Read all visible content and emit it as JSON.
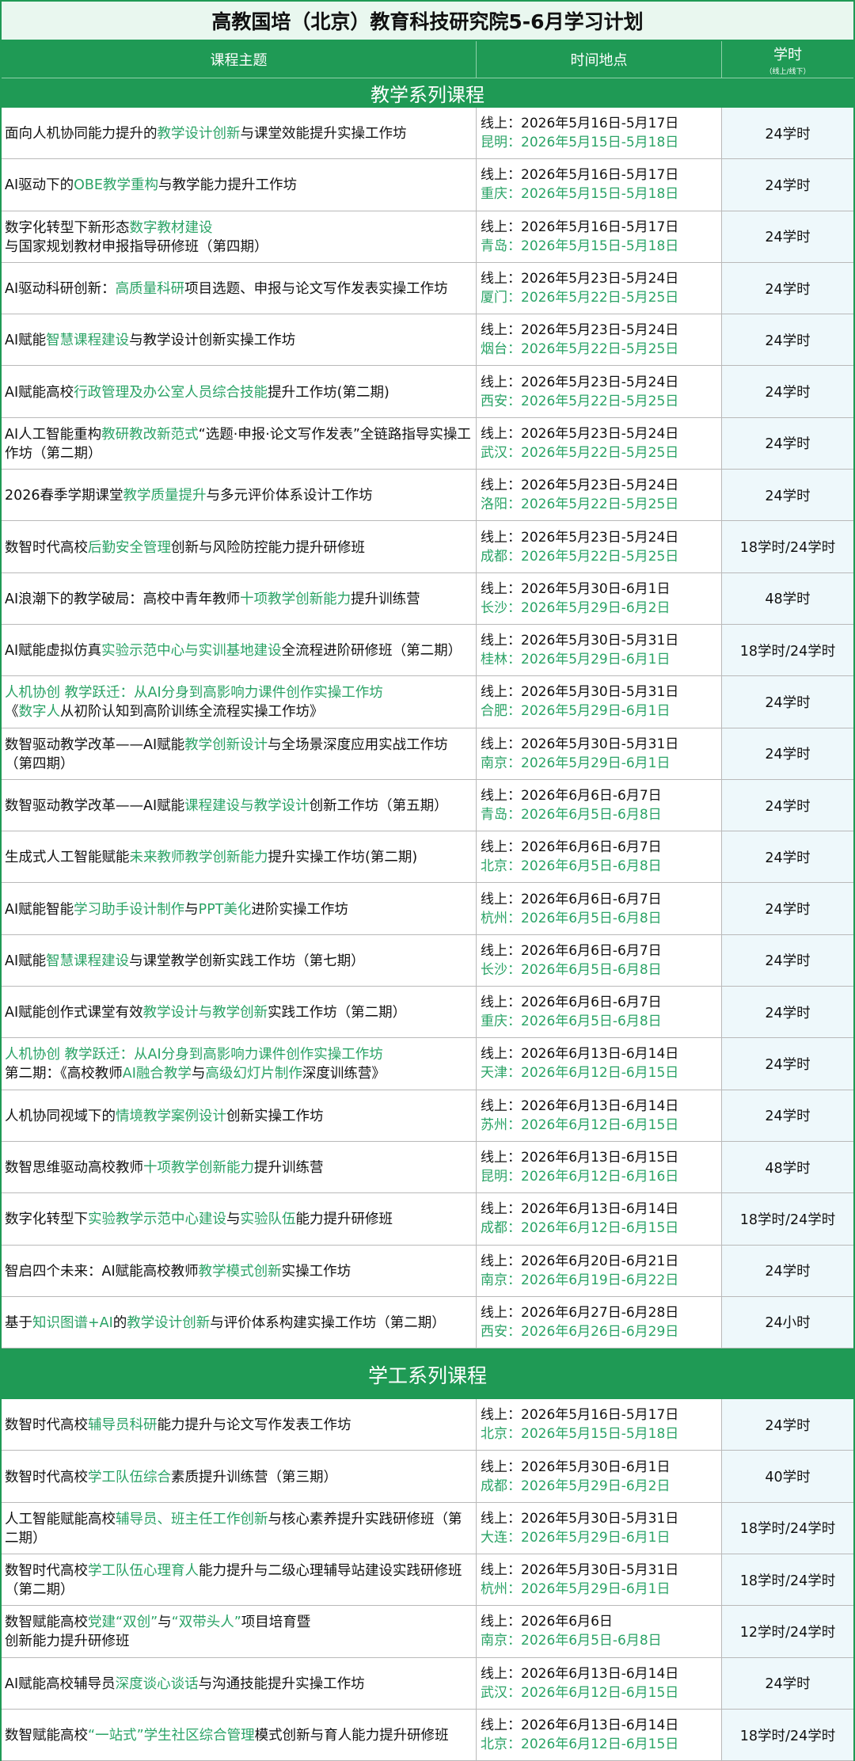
{
  "title": "高教国培（北京）教育科技研究院5-6月学习计划",
  "headers": {
    "topic": "课程主题",
    "time": "时间地点",
    "hours": "学时",
    "hours_sub": "（线上/线下）"
  },
  "sections": [
    {
      "name": "教学系列课程",
      "rows": [
        {
          "topic": [
            {
              "t": "面向人机协同能力提升的"
            },
            {
              "t": "教学设计创新",
              "hl": true
            },
            {
              "t": "与课堂效能提升实操工作坊"
            }
          ],
          "online": "线上：2026年5月16日-5月17日",
          "offline": "昆明：2026年5月15日-5月18日",
          "hours": "24学时"
        },
        {
          "topic": [
            {
              "t": "AI驱动下的"
            },
            {
              "t": "OBE教学重构",
              "hl": true
            },
            {
              "t": "与教学能力提升工作坊"
            }
          ],
          "online": "线上：2026年5月16日-5月17日",
          "offline": "重庆：2026年5月15日-5月18日",
          "hours": "24学时"
        },
        {
          "topic": [
            {
              "t": "数字化转型下新形态"
            },
            {
              "t": "数字教材建设",
              "hl": true
            },
            {
              "t": "与国家规划教材申报指导研修班（第四期）"
            }
          ],
          "online": "线上：2026年5月16日-5月17日",
          "offline": "青岛：2026年5月15日-5月18日",
          "hours": "24学时"
        },
        {
          "topic": [
            {
              "t": "AI驱动科研创新："
            },
            {
              "t": "高质量科研",
              "hl": true
            },
            {
              "t": "项目选题、申报与论文写作发表实操工作坊"
            }
          ],
          "online": "线上：2026年5月23日-5月24日",
          "offline": "厦门：2026年5月22日-5月25日",
          "hours": "24学时"
        },
        {
          "topic": [
            {
              "t": "AI赋能"
            },
            {
              "t": "智慧课程建设",
              "hl": true
            },
            {
              "t": "与教学设计创新实操工作坊"
            }
          ],
          "online": "线上：2026年5月23日-5月24日",
          "offline": "烟台：2026年5月22日-5月25日",
          "hours": "24学时"
        },
        {
          "topic": [
            {
              "t": "AI赋能高校"
            },
            {
              "t": "行政管理及办公室人员综合技能",
              "hl": true
            },
            {
              "t": "提升工作坊(第二期)"
            }
          ],
          "online": "线上：2026年5月23日-5月24日",
          "offline": "西安：2026年5月22日-5月25日",
          "hours": "24学时"
        },
        {
          "topic": [
            {
              "t": "AI人工智能重构"
            },
            {
              "t": "教研教改新范式",
              "hl": true
            },
            {
              "t": "“选题·申报·论文写作发表”全链路指导实操工作坊（第二期）"
            }
          ],
          "online": "线上：2026年5月23日-5月24日",
          "offline": "武汉：2026年5月22日-5月25日",
          "hours": "24学时"
        },
        {
          "topic": [
            {
              "t": "2026春季学期课堂"
            },
            {
              "t": "教学质量提升",
              "hl": true
            },
            {
              "t": "与多元评价体系设计工作坊"
            }
          ],
          "online": "线上：2026年5月23日-5月24日",
          "offline": "洛阳：2026年5月22日-5月25日",
          "hours": "24学时"
        },
        {
          "topic": [
            {
              "t": "数智时代高校"
            },
            {
              "t": "后勤安全管理",
              "hl": true
            },
            {
              "t": "创新与风险防控能力提升研修班"
            }
          ],
          "online": "线上：2026年5月23日-5月24日",
          "offline": "成都：2026年5月22日-5月25日",
          "hours": "18学时/24学时"
        },
        {
          "topic": [
            {
              "t": "AI浪潮下的教学破局：高校中青年教师"
            },
            {
              "t": "十项教学创新能力",
              "hl": true
            },
            {
              "t": "提升训练营"
            }
          ],
          "online": "线上：2026年5月30日-6月1日",
          "offline": "长沙：2026年5月29日-6月2日",
          "hours": "48学时"
        },
        {
          "topic": [
            {
              "t": "AI赋能虚拟仿真"
            },
            {
              "t": "实验示范中心与实训基地建设",
              "hl": true
            },
            {
              "t": "全流程进阶研修班（第二期）"
            }
          ],
          "online": "线上：2026年5月30日-5月31日",
          "offline": "桂林：2026年5月29日-6月1日",
          "hours": "18学时/24学时"
        },
        {
          "topic": [
            {
              "t": "人机协创 教学跃迁：从AI分身到高影响力课件创作实操工作坊",
              "hl": true,
              "br": true
            },
            {
              "t": "《"
            },
            {
              "t": "数字人",
              "hl": true
            },
            {
              "t": "从初阶认知到高阶训练全流程实操工作坊》"
            }
          ],
          "online": "线上：2026年5月30日-5月31日",
          "offline": "合肥：2026年5月29日-6月1日",
          "hours": "24学时"
        },
        {
          "topic": [
            {
              "t": "数智驱动教学改革——AI赋能"
            },
            {
              "t": "教学创新设计",
              "hl": true
            },
            {
              "t": "与全场景深度应用实战工作坊（第四期）"
            }
          ],
          "online": "线上：2026年5月30日-5月31日",
          "offline": "南京：2026年5月29日-6月1日",
          "hours": "24学时"
        },
        {
          "topic": [
            {
              "t": "数智驱动教学改革——AI赋能"
            },
            {
              "t": "课程建设与教学设计",
              "hl": true
            },
            {
              "t": "创新工作坊（第五期）"
            }
          ],
          "online": "线上：2026年6月6日-6月7日",
          "offline": "青岛：2026年6月5日-6月8日",
          "hours": "24学时"
        },
        {
          "topic": [
            {
              "t": "生成式人工智能赋能"
            },
            {
              "t": "未来教师教学创新能力",
              "hl": true
            },
            {
              "t": "提升实操工作坊(第二期)"
            }
          ],
          "online": "线上：2026年6月6日-6月7日",
          "offline": "北京：2026年6月5日-6月8日",
          "hours": "24学时"
        },
        {
          "topic": [
            {
              "t": "AI赋能智能"
            },
            {
              "t": "学习助手设计制作",
              "hl": true
            },
            {
              "t": "与"
            },
            {
              "t": "PPT美化",
              "hl": true
            },
            {
              "t": "进阶实操工作坊"
            }
          ],
          "online": "线上：2026年6月6日-6月7日",
          "offline": "杭州：2026年6月5日-6月8日",
          "hours": "24学时"
        },
        {
          "topic": [
            {
              "t": "AI赋能"
            },
            {
              "t": "智慧课程建设",
              "hl": true
            },
            {
              "t": "与课堂教学创新实践工作坊（第七期）"
            }
          ],
          "online": "线上：2026年6月6日-6月7日",
          "offline": "长沙：2026年6月5日-6月8日",
          "hours": "24学时"
        },
        {
          "topic": [
            {
              "t": "AI赋能创作式课堂有效"
            },
            {
              "t": "教学设计与教学创新",
              "hl": true
            },
            {
              "t": "实践工作坊（第二期）"
            }
          ],
          "online": "线上：2026年6月6日-6月7日",
          "offline": "重庆：2026年6月5日-6月8日",
          "hours": "24学时"
        },
        {
          "topic": [
            {
              "t": "人机协创 教学跃迁：从AI分身到高影响力课件创作实操工作坊",
              "hl": true,
              "br": true
            },
            {
              "t": "第二期：《高校教师"
            },
            {
              "t": "AI融合教学",
              "hl": true
            },
            {
              "t": "与"
            },
            {
              "t": "高级幻灯片制作",
              "hl": true
            },
            {
              "t": "深度训练营》"
            }
          ],
          "online": "线上：2026年6月13日-6月14日",
          "offline": "天津：2026年6月12日-6月15日",
          "hours": "24学时"
        },
        {
          "topic": [
            {
              "t": "人机协同视域下的"
            },
            {
              "t": "情境教学案例设计",
              "hl": true
            },
            {
              "t": "创新实操工作坊"
            }
          ],
          "online": "线上：2026年6月13日-6月14日",
          "offline": "苏州：2026年6月12日-6月15日",
          "hours": "24学时"
        },
        {
          "topic": [
            {
              "t": "数智思维驱动高校教师"
            },
            {
              "t": "十项教学创新能力",
              "hl": true
            },
            {
              "t": "提升训练营"
            }
          ],
          "online": "线上：2026年6月13日-6月15日",
          "offline": "昆明：2026年6月12日-6月16日",
          "hours": "48学时"
        },
        {
          "topic": [
            {
              "t": "数字化转型下"
            },
            {
              "t": "实验教学示范中心建设",
              "hl": true
            },
            {
              "t": "与"
            },
            {
              "t": "实验队伍",
              "hl": true
            },
            {
              "t": "能力提升研修班"
            }
          ],
          "online": "线上：2026年6月13日-6月14日",
          "offline": "成都：2026年6月12日-6月15日",
          "hours": "18学时/24学时"
        },
        {
          "topic": [
            {
              "t": "智启四个未来：AI赋能高校教师"
            },
            {
              "t": "教学模式创新",
              "hl": true
            },
            {
              "t": "实操工作坊"
            }
          ],
          "online": "线上：2026年6月20日-6月21日",
          "offline": "南京：2026年6月19日-6月22日",
          "hours": "24学时"
        },
        {
          "topic": [
            {
              "t": "基于"
            },
            {
              "t": "知识图谱+AI",
              "hl": true
            },
            {
              "t": "的"
            },
            {
              "t": "教学设计创新",
              "hl": true
            },
            {
              "t": "与评价体系构建实操工作坊（第二期）"
            }
          ],
          "online": "线上：2026年6月27日-6月28日",
          "offline": "西安：2026年6月26日-6月29日",
          "hours": "24小时"
        }
      ]
    },
    {
      "name": "学工系列课程",
      "rows": [
        {
          "topic": [
            {
              "t": "数智时代高校"
            },
            {
              "t": "辅导员科研",
              "hl": true
            },
            {
              "t": "能力提升与论文写作发表工作坊"
            }
          ],
          "online": "线上：2026年5月16日-5月17日",
          "offline": "北京：2026年5月15日-5月18日",
          "hours": "24学时"
        },
        {
          "topic": [
            {
              "t": "数智时代高校"
            },
            {
              "t": "学工队伍综合",
              "hl": true
            },
            {
              "t": "素质提升训练营（第三期）"
            }
          ],
          "online": "线上：2026年5月30日-6月1日",
          "offline": "成都：2026年5月29日-6月2日",
          "hours": "40学时"
        },
        {
          "topic": [
            {
              "t": "人工智能赋能高校"
            },
            {
              "t": "辅导员、班主任工作创新",
              "hl": true
            },
            {
              "t": "与核心素养提升实践研修班（第二期）"
            }
          ],
          "online": "线上：2026年5月30日-5月31日",
          "offline": "大连：2026年5月29日-6月1日",
          "hours": "18学时/24学时"
        },
        {
          "topic": [
            {
              "t": "数智时代高校"
            },
            {
              "t": "学工队伍心理育人",
              "hl": true
            },
            {
              "t": "能力提升与二级心理辅导站建设实践研修班（第二期）"
            }
          ],
          "online": "线上：2026年5月30日-5月31日",
          "offline": "杭州：2026年5月29日-6月1日",
          "hours": "18学时/24学时"
        },
        {
          "topic": [
            {
              "t": "数智赋能高校"
            },
            {
              "t": "党建“双创”",
              "hl": true
            },
            {
              "t": "与"
            },
            {
              "t": "“双带头人”",
              "hl": true
            },
            {
              "t": "项目培育暨",
              "br": true
            },
            {
              "t": "创新能力提升研修班"
            }
          ],
          "online": "线上：2026年6月6日",
          "offline": "南京：2026年6月5日-6月8日",
          "hours": "12学时/24学时"
        },
        {
          "topic": [
            {
              "t": "AI赋能高校辅导员"
            },
            {
              "t": "深度谈心谈话",
              "hl": true
            },
            {
              "t": "与沟通技能提升实操工作坊"
            }
          ],
          "online": "线上：2026年6月13日-6月14日",
          "offline": "武汉：2026年6月12日-6月15日",
          "hours": "24学时"
        },
        {
          "topic": [
            {
              "t": "数智赋能高校"
            },
            {
              "t": "“一站式”学生社区综合管理",
              "hl": true
            },
            {
              "t": "模式创新与育人能力提升研修班"
            }
          ],
          "online": "线上：2026年6月13日-6月14日",
          "offline": "北京：2026年6月12日-6月15日",
          "hours": "18学时/24学时"
        }
      ]
    }
  ],
  "colors": {
    "brand_green": "#1f9a55",
    "highlight_green": "#2aa366",
    "hours_bg": "#eef8fb"
  }
}
